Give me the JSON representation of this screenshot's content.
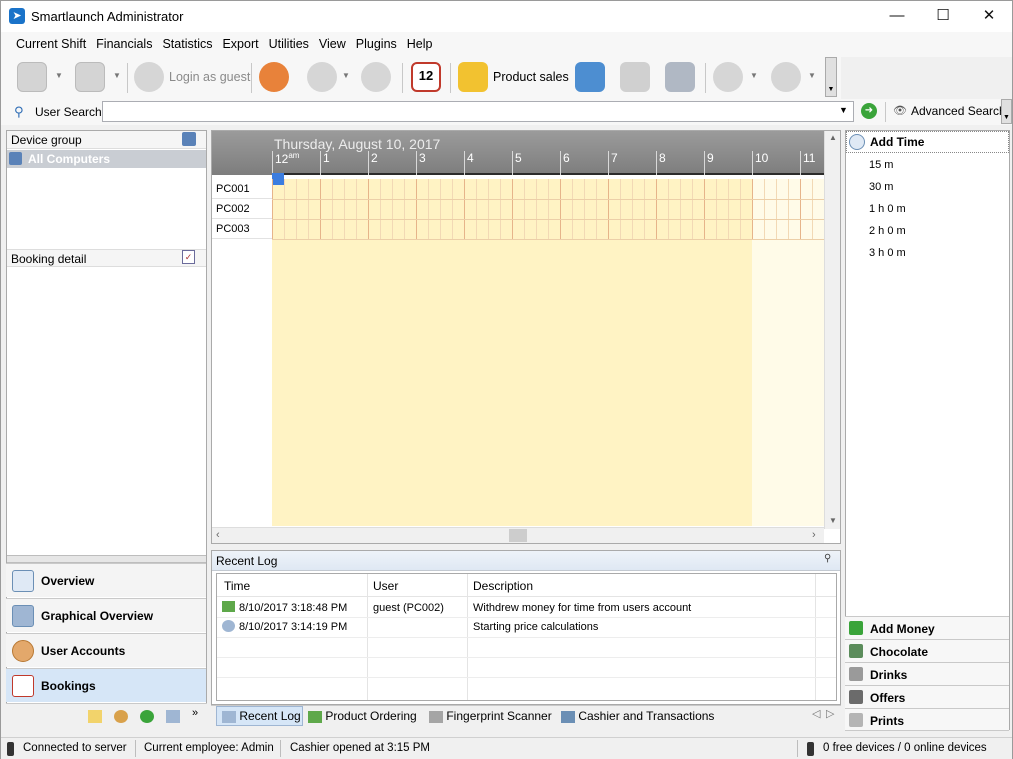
{
  "window": {
    "title": "Smartlaunch Administrator",
    "minimize": "—",
    "maximize": "☐",
    "close": "✕"
  },
  "menu": [
    "Current Shift",
    "Financials",
    "Statistics",
    "Export",
    "Utilities",
    "View",
    "Plugins",
    "Help"
  ],
  "toolbar": {
    "login_guest": "Login as guest",
    "product_sales": "Product sales",
    "calendar_day": "12"
  },
  "search": {
    "label": "User Search:",
    "value": "",
    "advanced": "Advanced Search"
  },
  "left": {
    "device_group": "Device group",
    "all_computers": "All Computers",
    "booking_detail": "Booking detail",
    "nav": [
      "Overview",
      "Graphical Overview",
      "User Accounts",
      "Bookings"
    ]
  },
  "calendar": {
    "date": "Thursday, August 10, 2017",
    "hours": [
      "12",
      "1",
      "2",
      "3",
      "4",
      "5",
      "6",
      "7",
      "8",
      "9",
      "10",
      "11"
    ],
    "am": "am",
    "pcs": [
      "PC001",
      "PC002",
      "PC003"
    ]
  },
  "right": {
    "add_time": "Add Time",
    "times": [
      "15 m",
      "30 m",
      "1 h 0 m",
      "2 h 0 m",
      "3 h 0 m"
    ],
    "buttons": [
      "Add Money",
      "Chocolate",
      "Drinks",
      "Offers",
      "Prints"
    ]
  },
  "log": {
    "title": "Recent Log",
    "columns": [
      "Time",
      "User",
      "Description"
    ],
    "rows": [
      {
        "time": "8/10/2017 3:18:48 PM",
        "user": "guest (PC002)",
        "desc": "Withdrew money for time from users account"
      },
      {
        "time": "8/10/2017 3:14:19 PM",
        "user": "",
        "desc": "Starting price calculations"
      }
    ]
  },
  "tabs": [
    "Recent Log",
    "Product Ordering",
    "Fingerprint Scanner",
    "Cashier and Transactions"
  ],
  "status": {
    "connection": "Connected to server",
    "employee": "Current employee: Admin",
    "cashier": "Cashier opened at 3:15 PM",
    "devices": "0 free devices / 0 online devices"
  },
  "colors": {
    "accent": "#1a73c9",
    "booking_bg": "#fff3c4",
    "selected": "#d6e6f7"
  }
}
